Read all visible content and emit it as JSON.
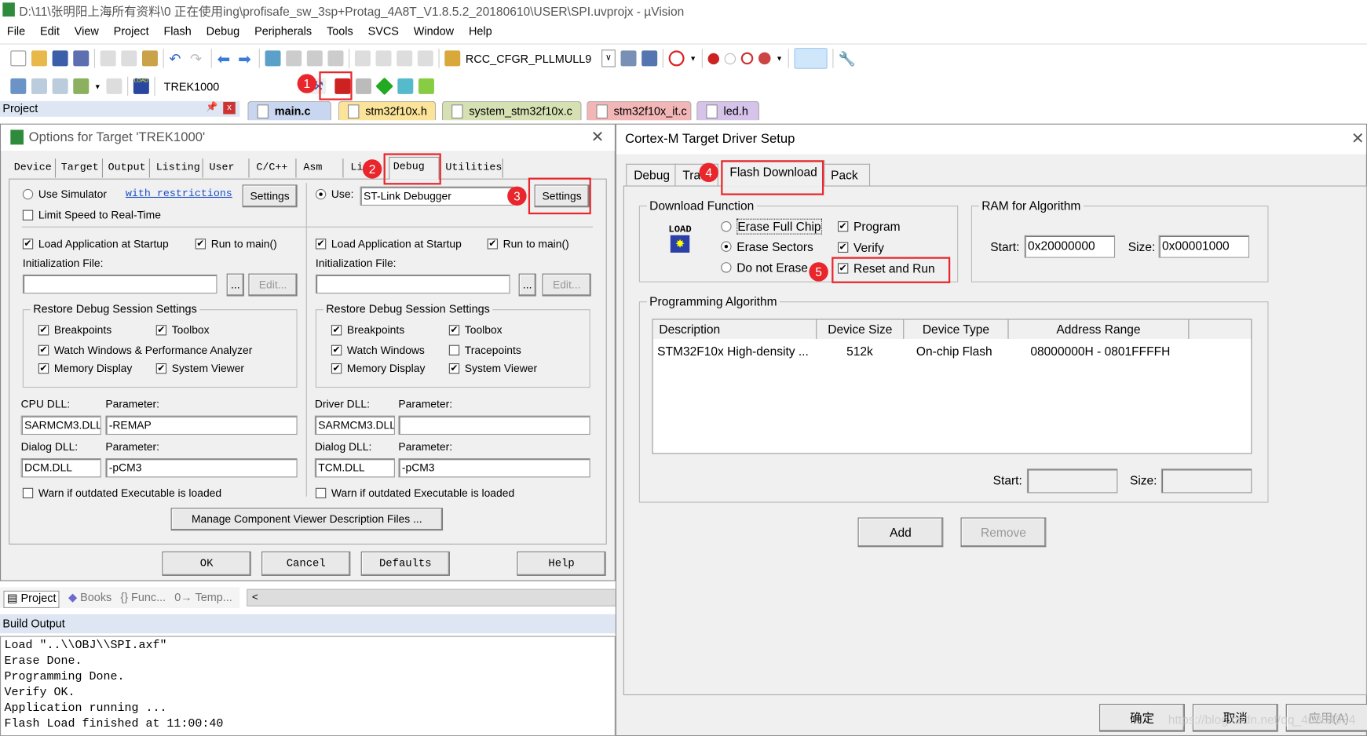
{
  "window": {
    "title": "D:\\11\\张明阳上海所有资料\\0 正在使用ing\\profisafe_sw_3sp+Protag_4A8T_V1.8.5.2_20180610\\USER\\SPI.uvprojx - µVision"
  },
  "menu": [
    "File",
    "Edit",
    "View",
    "Project",
    "Flash",
    "Debug",
    "Peripherals",
    "Tools",
    "SVCS",
    "Window",
    "Help"
  ],
  "toolbar": {
    "find_combo": "RCC_CFGR_PLLMULL9",
    "target": "TREK1000",
    "load_label": "LOAD"
  },
  "project_pane": {
    "title": "Project",
    "tabs": [
      "Project",
      "Books",
      "{} Func...",
      "0→ Temp..."
    ]
  },
  "editor_tabs": [
    {
      "label": "main.c",
      "color": "#c9d6ef"
    },
    {
      "label": "stm32f10x.h",
      "color": "#fbe49a"
    },
    {
      "label": "system_stm32f10x.c",
      "color": "#d6e1b3"
    },
    {
      "label": "stm32f10x_it.c",
      "color": "#f3b6b6"
    },
    {
      "label": "led.h",
      "color": "#d5c3ea"
    }
  ],
  "options": {
    "title": "Options for Target 'TREK1000'",
    "tabs": [
      "Device",
      "Target",
      "Output",
      "Listing",
      "User",
      "C/C++",
      "Asm",
      "Li",
      "Debug",
      "Utilities"
    ],
    "left": {
      "use_simulator": "Use Simulator",
      "restrictions": "with restrictions",
      "settings": "Settings",
      "limit_speed": "Limit Speed to Real-Time",
      "load_app": "Load Application at Startup",
      "run_main": "Run to main()",
      "init_file": "Initialization File:",
      "browse": "...",
      "edit": "Edit...",
      "restore": "Restore Debug Session Settings",
      "breakpoints": "Breakpoints",
      "toolbox": "Toolbox",
      "watch": "Watch Windows & Performance Analyzer",
      "memory": "Memory Display",
      "sysviewer": "System Viewer",
      "cpu_dll": "CPU DLL:",
      "param": "Parameter:",
      "cpu_dll_val": "SARMCM3.DLL",
      "cpu_param_val": "-REMAP",
      "dialog_dll": "Dialog DLL:",
      "dialog_dll_val": "DCM.DLL",
      "dialog_param_val": "-pCM3",
      "warn": "Warn if outdated Executable is loaded"
    },
    "right": {
      "use": "Use:",
      "debugger": "ST-Link Debugger",
      "settings": "Settings",
      "load_app": "Load Application at Startup",
      "run_main": "Run to main()",
      "init_file": "Initialization File:",
      "browse": "...",
      "edit": "Edit...",
      "restore": "Restore Debug Session Settings",
      "breakpoints": "Breakpoints",
      "toolbox": "Toolbox",
      "watch": "Watch Windows",
      "tracepoints": "Tracepoints",
      "memory": "Memory Display",
      "sysviewer": "System Viewer",
      "driver_dll": "Driver DLL:",
      "param": "Parameter:",
      "driver_dll_val": "SARMCM3.DLL",
      "driver_param_val": "",
      "dialog_dll": "Dialog DLL:",
      "dialog_dll_val": "TCM.DLL",
      "dialog_param_val": "-pCM3",
      "warn": "Warn if outdated Executable is loaded"
    },
    "manage": "Manage Component Viewer Description Files ...",
    "buttons": {
      "ok": "OK",
      "cancel": "Cancel",
      "defaults": "Defaults",
      "help": "Help"
    }
  },
  "cortex": {
    "title": "Cortex-M Target Driver Setup",
    "tabs": [
      "Debug",
      "Tra",
      "Flash Download",
      "Pack"
    ],
    "download_function": "Download Function",
    "load_label": "LOAD",
    "erase_full": "Erase Full Chip",
    "erase_sectors": "Erase Sectors",
    "no_erase": "Do not Erase",
    "program": "Program",
    "verify": "Verify",
    "reset_run": "Reset and Run",
    "ram": "RAM for Algorithm",
    "start": "Start:",
    "size": "Size:",
    "ram_start": "0x20000000",
    "ram_size": "0x00001000",
    "prog_alg": "Programming Algorithm",
    "columns": [
      "Description",
      "Device Size",
      "Device Type",
      "Address Range"
    ],
    "rows": [
      [
        "STM32F10x High-density ...",
        "512k",
        "On-chip Flash",
        "08000000H - 0801FFFFH"
      ]
    ],
    "alg_start": "",
    "alg_size": "",
    "add": "Add",
    "remove": "Remove",
    "ok": "确定",
    "cancel": "取消",
    "apply": "应用(A)",
    "watermark": "https://blog.csdn.net/qq_40304934"
  },
  "build_output": {
    "title": "Build Output",
    "lines": [
      "Load \"..\\\\OBJ\\\\SPI.axf\"",
      "Erase Done.",
      "Programming Done.",
      "Verify OK.",
      "Application running ...",
      "Flash Load finished at 11:00:40"
    ]
  },
  "markers": [
    "1",
    "2",
    "3",
    "4",
    "5"
  ],
  "colors": {
    "annotation": "#e8262b"
  }
}
